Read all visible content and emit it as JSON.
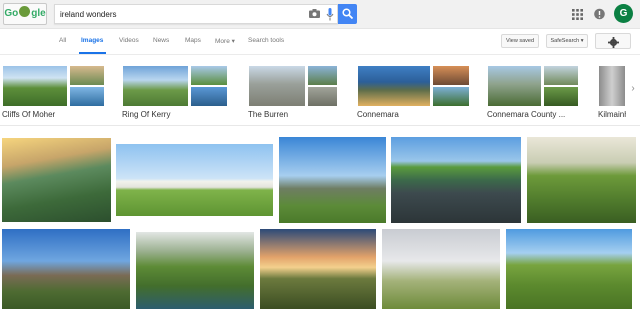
{
  "logo": {
    "text_left": "Go",
    "text_right": "gle"
  },
  "search": {
    "query": "ireland wonders"
  },
  "avatar": {
    "letter": "G"
  },
  "tabs": [
    {
      "label": "All",
      "active": false
    },
    {
      "label": "Images",
      "active": true
    },
    {
      "label": "Videos",
      "active": false
    },
    {
      "label": "News",
      "active": false
    },
    {
      "label": "Maps",
      "active": false
    },
    {
      "label": "More ▾",
      "active": false
    },
    {
      "label": "Search tools",
      "active": false
    }
  ],
  "buttons": {
    "view_saved": "View saved",
    "safesearch": "SafeSearch ▾"
  },
  "related": [
    {
      "label": "Cliffs Of Moher"
    },
    {
      "label": "Ring Of Kerry"
    },
    {
      "label": "The Burren"
    },
    {
      "label": "Connemara"
    },
    {
      "label": "Connemara County ..."
    },
    {
      "label": "Kilmainham"
    }
  ],
  "colors": {
    "accent": "#1a73e8",
    "search_button": "#4285f4",
    "avatar": "#0b8043"
  }
}
